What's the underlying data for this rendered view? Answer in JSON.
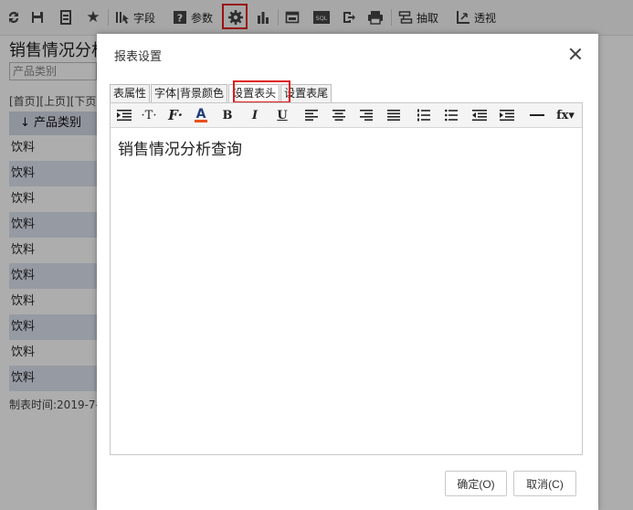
{
  "toolbar": {
    "field_label": "字段",
    "param_label": "参数",
    "extract_label": "抽取",
    "pivot_label": "透视",
    "sql_label": "SQL"
  },
  "background": {
    "report_title": "销售情况分析",
    "filter_value": "产品类别",
    "pager": "[首页][上页][下页]",
    "column_header": "↓ 产品类别",
    "rows": [
      "饮料",
      "饮料",
      "饮料",
      "饮料",
      "饮料",
      "饮料",
      "饮料",
      "饮料",
      "饮料",
      "饮料"
    ],
    "footer": "制表时间:2019-7-"
  },
  "dialog": {
    "title": "报表设置",
    "tabs": [
      "表属性",
      "字体|背景颜色",
      "设置表头",
      "设置表尾"
    ],
    "active_tab": "设置表头",
    "editor_content": "销售情况分析查询",
    "ok_label": "确定(O)",
    "cancel_label": "取消(C)"
  },
  "colors": {
    "highlight": "#e01b1b",
    "row_alt": "#dde3f0",
    "header_bg": "#d3d9e6"
  }
}
